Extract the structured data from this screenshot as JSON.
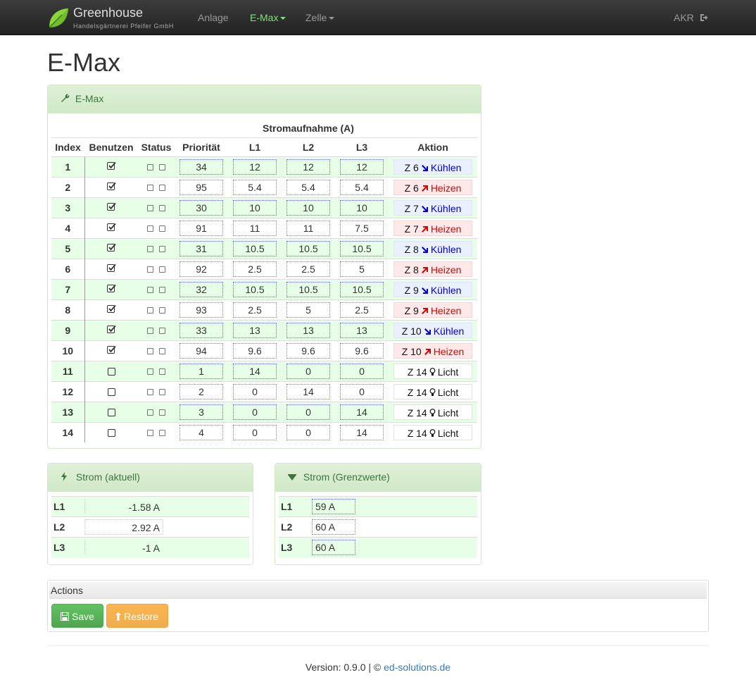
{
  "brand": {
    "title": "Greenhouse",
    "subtitle": "Handelsgärtnerei Pfeifer GmbH",
    "logo_icon": "leaf-icon"
  },
  "nav": {
    "items": [
      {
        "label": "Anlage",
        "active": false,
        "dropdown": false
      },
      {
        "label": "E-Max",
        "active": true,
        "dropdown": true
      },
      {
        "label": "Zelle",
        "active": false,
        "dropdown": true
      }
    ],
    "user": "AKR",
    "logout_icon": "logout-icon"
  },
  "page_title": "E-Max",
  "emax_panel": {
    "heading": "E-Max",
    "heading_icon": "wrench-icon",
    "group_header": "Stromaufnahme (A)",
    "columns": [
      "Index",
      "Benutzen",
      "Status",
      "Priorität",
      "L1",
      "L2",
      "L3",
      "Aktion"
    ],
    "rows": [
      {
        "index": "1",
        "use": true,
        "priority": "34",
        "l1": "12",
        "l2": "12",
        "l3": "12",
        "zone": "Z 6",
        "action": "Kühlen",
        "type": "cool"
      },
      {
        "index": "2",
        "use": true,
        "priority": "95",
        "l1": "5.4",
        "l2": "5.4",
        "l3": "5.4",
        "zone": "Z 6",
        "action": "Heizen",
        "type": "heat"
      },
      {
        "index": "3",
        "use": true,
        "priority": "30",
        "l1": "10",
        "l2": "10",
        "l3": "10",
        "zone": "Z 7",
        "action": "Kühlen",
        "type": "cool"
      },
      {
        "index": "4",
        "use": true,
        "priority": "91",
        "l1": "11",
        "l2": "11",
        "l3": "7.5",
        "zone": "Z 7",
        "action": "Heizen",
        "type": "heat"
      },
      {
        "index": "5",
        "use": true,
        "priority": "31",
        "l1": "10.5",
        "l2": "10.5",
        "l3": "10.5",
        "zone": "Z 8",
        "action": "Kühlen",
        "type": "cool"
      },
      {
        "index": "6",
        "use": true,
        "priority": "92",
        "l1": "2.5",
        "l2": "2.5",
        "l3": "5",
        "zone": "Z 8",
        "action": "Heizen",
        "type": "heat"
      },
      {
        "index": "7",
        "use": true,
        "priority": "32",
        "l1": "10.5",
        "l2": "10.5",
        "l3": "10.5",
        "zone": "Z 9",
        "action": "Kühlen",
        "type": "cool"
      },
      {
        "index": "8",
        "use": true,
        "priority": "93",
        "l1": "2.5",
        "l2": "5",
        "l3": "2.5",
        "zone": "Z 9",
        "action": "Heizen",
        "type": "heat"
      },
      {
        "index": "9",
        "use": true,
        "priority": "33",
        "l1": "13",
        "l2": "13",
        "l3": "13",
        "zone": "Z 10",
        "action": "Kühlen",
        "type": "cool"
      },
      {
        "index": "10",
        "use": true,
        "priority": "94",
        "l1": "9.6",
        "l2": "9.6",
        "l3": "9.6",
        "zone": "Z 10",
        "action": "Heizen",
        "type": "heat"
      },
      {
        "index": "11",
        "use": false,
        "priority": "1",
        "l1": "14",
        "l2": "0",
        "l3": "0",
        "zone": "Z 14",
        "action": "Licht",
        "type": "light"
      },
      {
        "index": "12",
        "use": false,
        "priority": "2",
        "l1": "0",
        "l2": "14",
        "l3": "0",
        "zone": "Z 14",
        "action": "Licht",
        "type": "light"
      },
      {
        "index": "13",
        "use": false,
        "priority": "3",
        "l1": "0",
        "l2": "0",
        "l3": "14",
        "zone": "Z 14",
        "action": "Licht",
        "type": "light"
      },
      {
        "index": "14",
        "use": false,
        "priority": "4",
        "l1": "0",
        "l2": "0",
        "l3": "14",
        "zone": "Z 14",
        "action": "Licht",
        "type": "light"
      }
    ]
  },
  "current_panel": {
    "heading": "Strom (aktuell)",
    "heading_icon": "bolt-icon",
    "rows": [
      {
        "label": "L1",
        "value": "-1.58 A"
      },
      {
        "label": "L2",
        "value": "2.92 A"
      },
      {
        "label": "L3",
        "value": "-1 A"
      }
    ]
  },
  "limit_panel": {
    "heading": "Strom (Grenzwerte)",
    "heading_icon": "caret-down-icon",
    "rows": [
      {
        "label": "L1",
        "value": "59 A"
      },
      {
        "label": "L2",
        "value": "60 A"
      },
      {
        "label": "L3",
        "value": "60 A"
      }
    ]
  },
  "actions": {
    "heading": "Actions",
    "save_label": "Save",
    "save_icon": "floppy-icon",
    "restore_label": "Restore",
    "restore_icon": "upload-icon"
  },
  "footer": {
    "prefix": "Version: 0.9.0 | © ",
    "link": "ed-solutions.de"
  },
  "colors": {
    "row_highlight": "#e6ffe6",
    "panel_heading": "#dff0d8",
    "cool": "#0000cc",
    "heat": "#dd0000",
    "active_nav": "#7ee07e",
    "save": "#5cb85c",
    "restore": "#f0ad4e"
  }
}
